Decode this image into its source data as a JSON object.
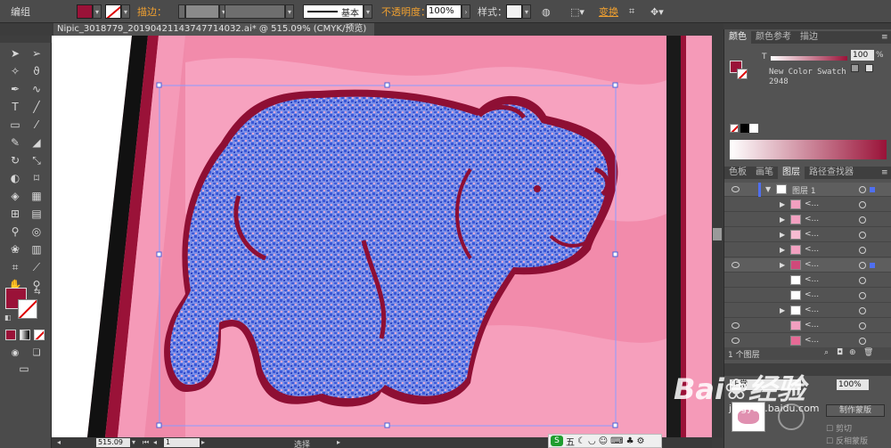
{
  "control_bar": {
    "group_label": "编组",
    "stroke_label": "描边：",
    "stroke_style": "基本",
    "opacity_label": "不透明度：",
    "opacity_value": "100%",
    "style_label": "样式：",
    "transform_label": "变换",
    "fill_color": "#9a1238"
  },
  "document": {
    "tab_title": "Nipic_3018779_20190421143747714032.ai* @ 515.09% (CMYK/预览)",
    "close_glyph": "×"
  },
  "status_bar": {
    "zoom": "515.09",
    "page": "1",
    "tool": "选择"
  },
  "colors": {
    "canvas_bg": "#f08aaa",
    "bear_fill": "#6f86e6",
    "bear_outline": "#8e0f34",
    "accent_red": "#9a1238",
    "selection": "#8a9cff"
  },
  "color_panel": {
    "tabs": [
      "颜色",
      "颜色参考",
      "描边"
    ],
    "t_label": "T",
    "t_value": "100",
    "percent": "%",
    "swatch_name": "New Color Swatch",
    "swatch_number": "2948"
  },
  "layers_panel": {
    "tabs": [
      "色板",
      "画笔",
      "图层",
      "路径查找器"
    ],
    "layer_name": "图层 1",
    "sublayer_label": "<...",
    "footer": "1 个图层"
  },
  "transparency_panel": {
    "mode_value": "正常",
    "opacity_value": "100%",
    "make_mask": "制作蒙版",
    "clip": "剪切",
    "invert_mask": "反相蒙版"
  },
  "watermark": {
    "brand": "Bai",
    "brand2": "经验",
    "url": "jingyan.baidu.com"
  },
  "taskbar": {
    "ime": "五"
  }
}
